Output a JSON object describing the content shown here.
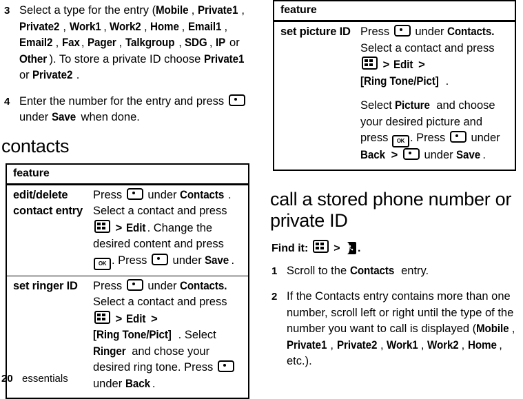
{
  "page": {
    "number": "20",
    "section_label": "essentials"
  },
  "left_column": {
    "steps": [
      {
        "num": "3",
        "parts": [
          {
            "t": "Select a type for the entry (",
            "b": false
          },
          {
            "t": "Mobile",
            "b": true
          },
          {
            "t": ", ",
            "b": false
          },
          {
            "t": "Private1",
            "b": true
          },
          {
            "t": ", ",
            "b": false
          },
          {
            "t": "Private2",
            "b": true
          },
          {
            "t": ", ",
            "b": false
          },
          {
            "t": "Work1",
            "b": true
          },
          {
            "t": ", ",
            "b": false
          },
          {
            "t": "Work2",
            "b": true
          },
          {
            "t": ", ",
            "b": false
          },
          {
            "t": "Home",
            "b": true
          },
          {
            "t": ", ",
            "b": false
          },
          {
            "t": "Email1",
            "b": true
          },
          {
            "t": ", ",
            "b": false
          },
          {
            "t": "Email2",
            "b": true
          },
          {
            "t": ", ",
            "b": false
          },
          {
            "t": "Fax",
            "b": true
          },
          {
            "t": ", ",
            "b": false
          },
          {
            "t": "Pager",
            "b": true
          },
          {
            "t": ", ",
            "b": false
          },
          {
            "t": "Talkgroup",
            "b": true
          },
          {
            "t": ", ",
            "b": false
          },
          {
            "t": "SDG",
            "b": true
          },
          {
            "t": ", ",
            "b": false
          },
          {
            "t": "IP",
            "b": true
          },
          {
            "t": " or ",
            "b": false
          },
          {
            "t": "Other",
            "b": true
          },
          {
            "t": "). To store a private ID choose ",
            "b": false
          },
          {
            "t": "Private1",
            "b": true
          },
          {
            "t": " or ",
            "b": false
          },
          {
            "t": "Private2",
            "b": true
          },
          {
            "t": ".",
            "b": false
          }
        ]
      },
      {
        "num": "4",
        "parts": [
          {
            "t": "Enter the number for the entry and press ",
            "b": false
          },
          {
            "icon": "softkey-icon"
          },
          {
            "t": " under ",
            "b": false
          },
          {
            "t": "Save",
            "b": true
          },
          {
            "t": " when done.",
            "b": false
          }
        ]
      }
    ],
    "section_heading": "contacts",
    "table": {
      "header": "feature",
      "rows": [
        {
          "label": "edit/delete contact entry",
          "paragraphs": [
            [
              {
                "t": "Press ",
                "b": false
              },
              {
                "icon": "softkey-icon"
              },
              {
                "t": " under ",
                "b": false
              },
              {
                "t": "Contacts",
                "b": true
              },
              {
                "t": ". Select a contact and press ",
                "b": false
              },
              {
                "icon": "menu-icon"
              },
              {
                "t": " > ",
                "b": false,
                "gt": true
              },
              {
                "t": "Edit",
                "b": true
              },
              {
                "t": ". Change the desired content and press ",
                "b": false
              },
              {
                "icon": "ok-icon"
              },
              {
                "t": ". Press ",
                "b": false
              },
              {
                "icon": "softkey-icon"
              },
              {
                "t": " under ",
                "b": false
              },
              {
                "t": "Save",
                "b": true
              },
              {
                "t": ".",
                "b": false
              }
            ]
          ]
        },
        {
          "label": "set ringer ID",
          "paragraphs": [
            [
              {
                "t": "Press ",
                "b": false
              },
              {
                "icon": "softkey-icon"
              },
              {
                "t": " under ",
                "b": false
              },
              {
                "t": "Contacts.",
                "b": true
              },
              {
                "t": " Select a contact and press ",
                "b": false
              },
              {
                "icon": "menu-icon"
              },
              {
                "t": " > ",
                "b": false,
                "gt": true
              },
              {
                "t": "Edit",
                "b": true
              },
              {
                "t": " > ",
                "b": false,
                "gt": true
              },
              {
                "t": "[Ring Tone/Pict]",
                "b": true
              },
              {
                "t": ". Select ",
                "b": false
              },
              {
                "t": "Ringer",
                "b": true
              },
              {
                "t": " and chose your desired ring tone. Press ",
                "b": false
              },
              {
                "icon": "softkey-icon"
              },
              {
                "t": " under ",
                "b": false
              },
              {
                "t": "Back",
                "b": true
              },
              {
                "t": ".",
                "b": false
              }
            ]
          ]
        }
      ]
    }
  },
  "right_column": {
    "table": {
      "header": "feature",
      "rows": [
        {
          "label": "set picture ID",
          "paragraphs": [
            [
              {
                "t": "Press ",
                "b": false
              },
              {
                "icon": "softkey-icon"
              },
              {
                "t": " under ",
                "b": false
              },
              {
                "t": "Contacts.",
                "b": true
              },
              {
                "t": " Select a contact and press ",
                "b": false
              },
              {
                "icon": "menu-icon"
              },
              {
                "t": " > ",
                "b": false,
                "gt": true
              },
              {
                "t": "Edit",
                "b": true
              },
              {
                "t": " > ",
                "b": false,
                "gt": true
              },
              {
                "t": "[Ring Tone/Pict]",
                "b": true
              },
              {
                "t": ".",
                "b": false
              }
            ],
            [
              {
                "t": "Select ",
                "b": false
              },
              {
                "t": "Picture",
                "b": true
              },
              {
                "t": " and choose your desired picture and press ",
                "b": false
              },
              {
                "icon": "ok-icon"
              },
              {
                "t": ". Press ",
                "b": false
              },
              {
                "icon": "softkey-icon"
              },
              {
                "t": " under ",
                "b": false
              },
              {
                "t": "Back",
                "b": true
              },
              {
                "t": " > ",
                "b": false,
                "gt": true
              },
              {
                "icon": "softkey-icon"
              },
              {
                "t": " under ",
                "b": false
              },
              {
                "t": "Save",
                "b": true
              },
              {
                "t": ".",
                "b": false
              }
            ]
          ]
        }
      ]
    },
    "section_heading": "call a stored phone number or private ID",
    "find_it": {
      "label": "Find it:",
      "icons": [
        "menu-icon",
        "contacts-icon"
      ],
      "separator": ">",
      "trailing": "."
    },
    "steps": [
      {
        "num": "1",
        "parts": [
          {
            "t": "Scroll to the ",
            "b": false
          },
          {
            "t": "Contacts",
            "b": true
          },
          {
            "t": " entry.",
            "b": false
          }
        ]
      },
      {
        "num": "2",
        "parts": [
          {
            "t": "If the Contacts entry contains more than one number, scroll left or right until the type of the number you want to call is displayed (",
            "b": false
          },
          {
            "t": "Mobile",
            "b": true
          },
          {
            "t": ", ",
            "b": false
          },
          {
            "t": "Private1",
            "b": true
          },
          {
            "t": ", ",
            "b": false
          },
          {
            "t": "Private2",
            "b": true
          },
          {
            "t": ", ",
            "b": false
          },
          {
            "t": "Work1",
            "b": true
          },
          {
            "t": ", ",
            "b": false
          },
          {
            "t": "Work2",
            "b": true
          },
          {
            "t": ", ",
            "b": false
          },
          {
            "t": "Home",
            "b": true
          },
          {
            "t": ", etc.).",
            "b": false
          }
        ]
      }
    ]
  },
  "icons": {
    "softkey-icon": "soft key (rounded rect with centre dot)",
    "menu-icon": "menu key (rounded rect with four squares)",
    "ok-icon": "OK key",
    "contacts-icon": "contacts phonebook icon"
  }
}
